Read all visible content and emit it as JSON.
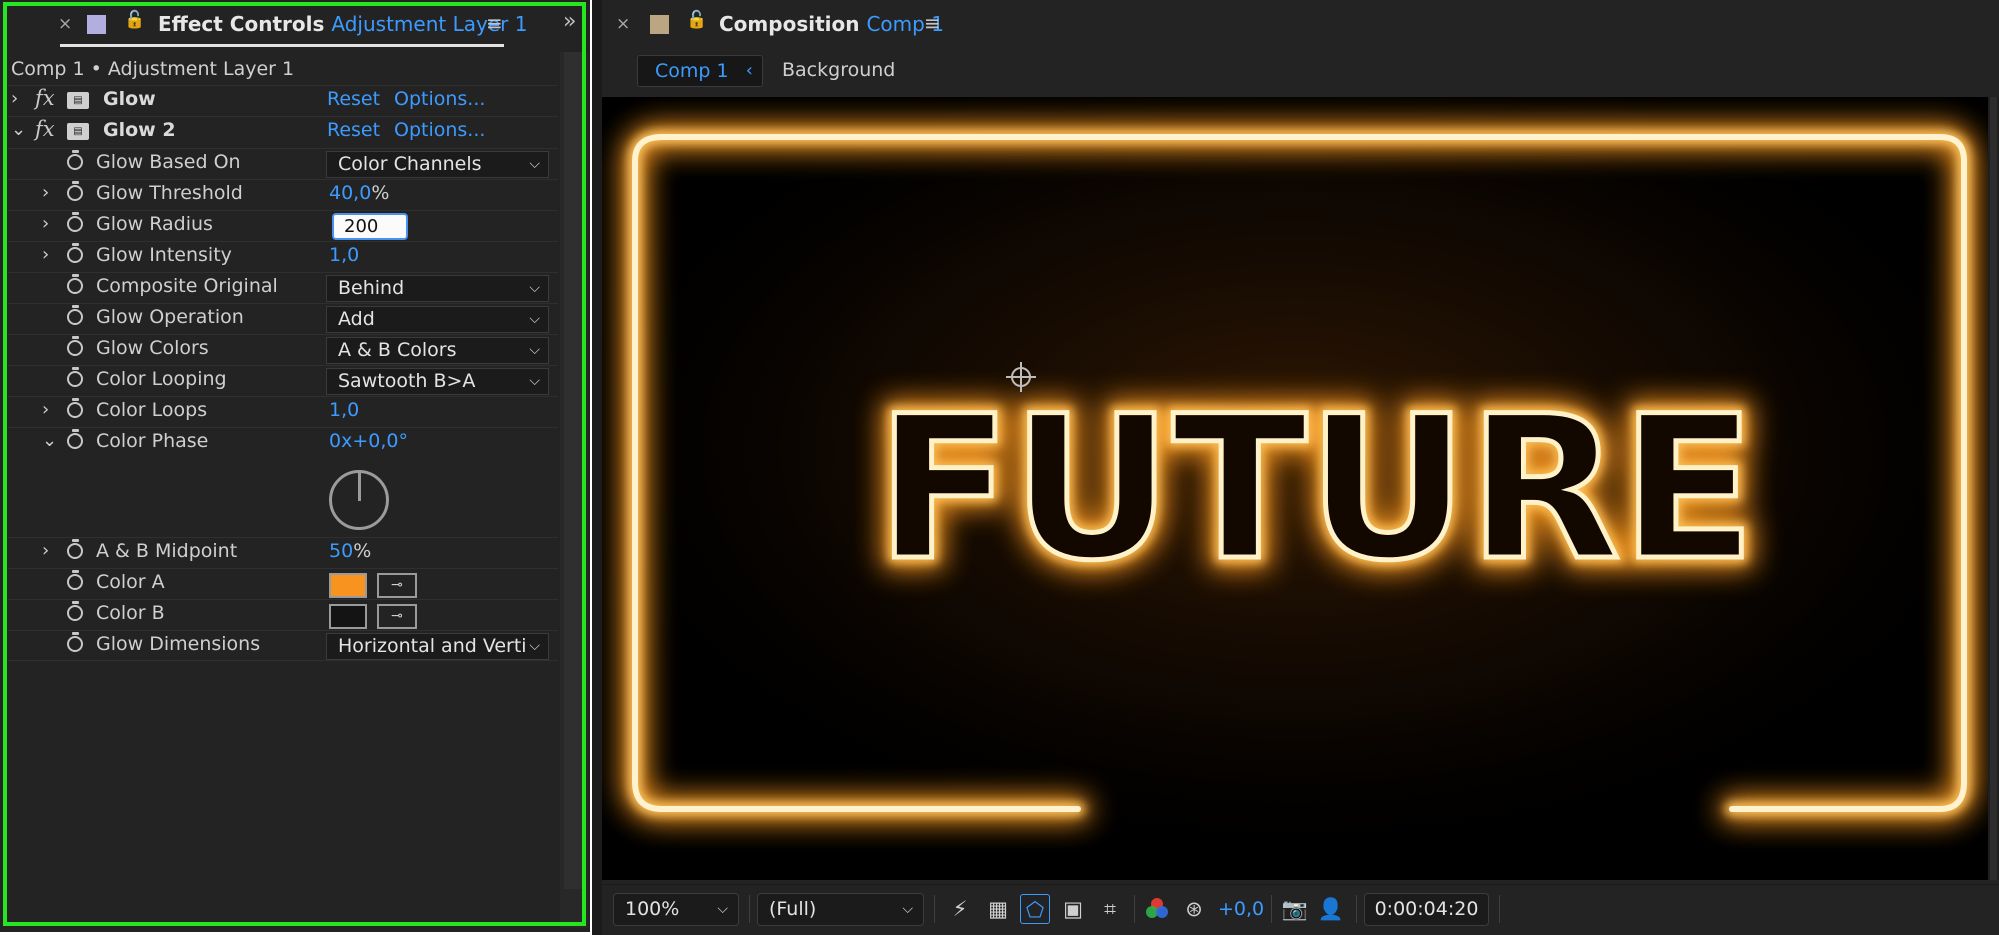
{
  "effect_controls": {
    "close": "×",
    "title": "Effect Controls",
    "layer": "Adjustment Layer 1",
    "menu": "≡",
    "collapse": "»",
    "breadcrumb": "Comp 1 • Adjustment Layer 1",
    "effects": [
      {
        "expand": "›",
        "fx": "fx",
        "name": "Glow",
        "reset": "Reset",
        "options": "Options..."
      },
      {
        "expand": "⌄",
        "fx": "fx",
        "name": "Glow 2",
        "reset": "Reset",
        "options": "Options..."
      }
    ],
    "props": {
      "glow_based_on": {
        "label": "Glow Based On",
        "value": "Color Channels"
      },
      "glow_threshold": {
        "label": "Glow Threshold",
        "value": "40,0",
        "unit": "%"
      },
      "glow_radius": {
        "label": "Glow Radius",
        "value": "200"
      },
      "glow_intensity": {
        "label": "Glow Intensity",
        "value": "1,0"
      },
      "composite_original": {
        "label": "Composite Original",
        "value": "Behind"
      },
      "glow_operation": {
        "label": "Glow Operation",
        "value": "Add"
      },
      "glow_colors": {
        "label": "Glow Colors",
        "value": "A & B Colors"
      },
      "color_looping": {
        "label": "Color Looping",
        "value": "Sawtooth B>A"
      },
      "color_loops": {
        "label": "Color Loops",
        "value": "1,0"
      },
      "color_phase": {
        "label": "Color Phase",
        "value": "0x+0,0°"
      },
      "ab_midpoint": {
        "label": "A & B Midpoint",
        "value": "50",
        "unit": "%"
      },
      "color_a": {
        "label": "Color A",
        "color": "#f7931e"
      },
      "color_b": {
        "label": "Color B",
        "color": "#141414"
      },
      "glow_dimensions": {
        "label": "Glow Dimensions",
        "value": "Horizontal and Verti"
      }
    }
  },
  "composition": {
    "close": "×",
    "title": "Composition",
    "comp": "Comp 1",
    "menu": "≡",
    "tabs": {
      "active": "Comp 1",
      "other": "Background"
    },
    "viewer_text": "FUTURE",
    "glow_color": "#ffb43c",
    "toolbar": {
      "zoom": "100%",
      "resolution": "(Full)",
      "exposure": "+0,0",
      "timecode": "0:00:04:20"
    }
  },
  "colors": {
    "accent": "#3c9bff",
    "highlight_frame": "#27e51f"
  }
}
